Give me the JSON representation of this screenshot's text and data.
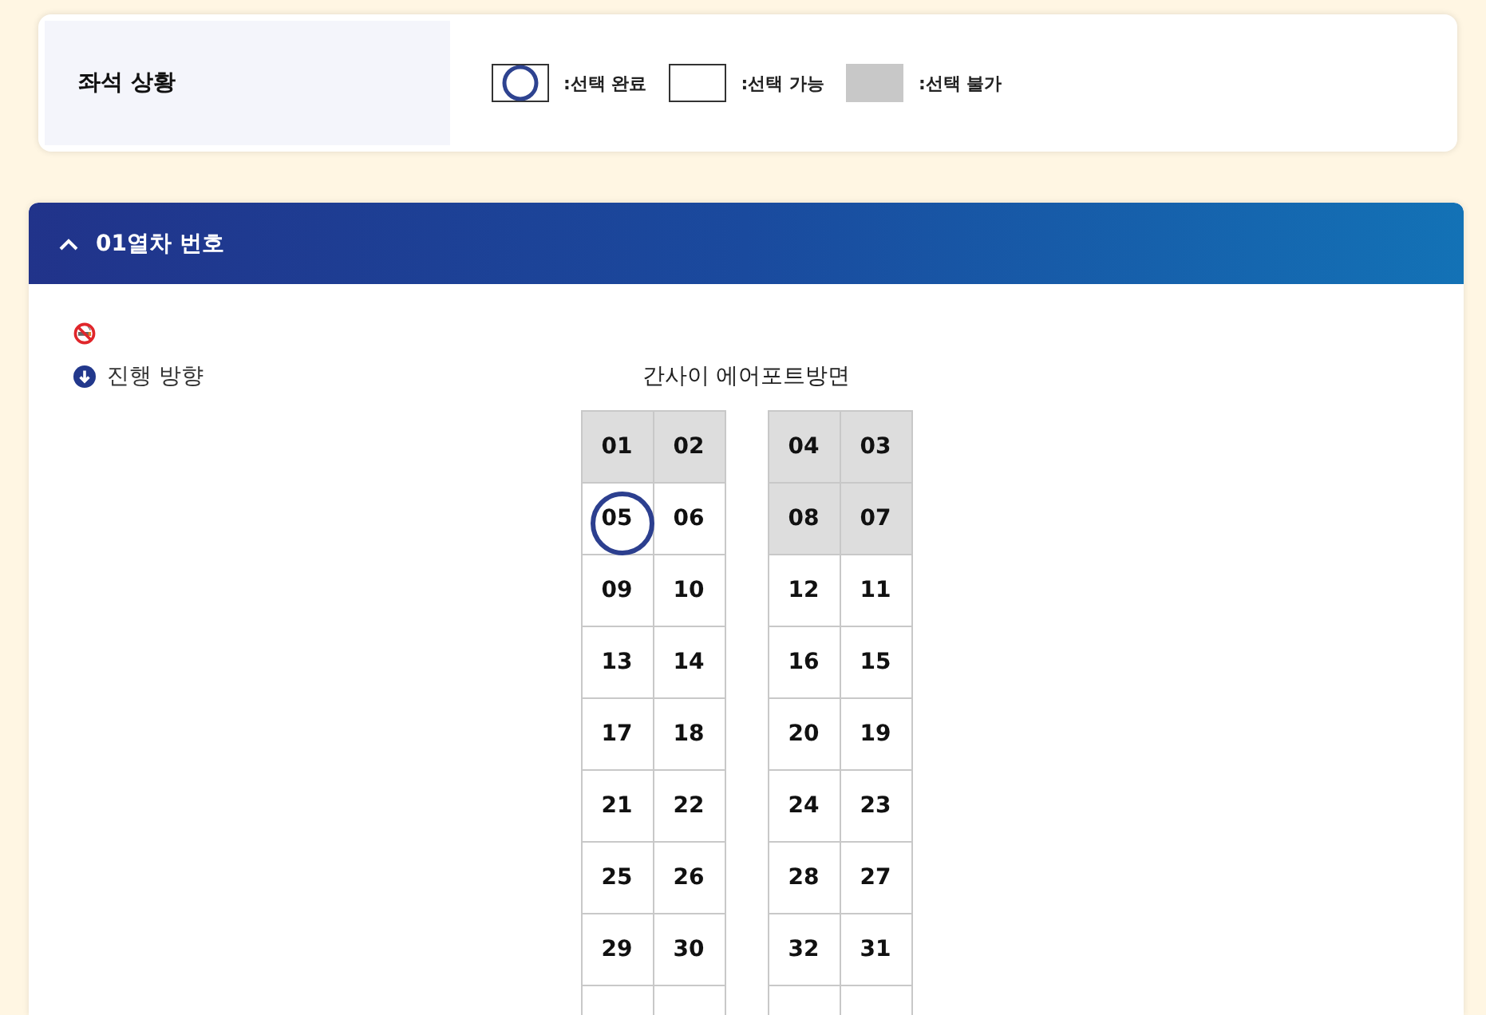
{
  "legend": {
    "title": "좌석 상황",
    "items": [
      {
        "kind": "selected",
        "label": ":선택 완료"
      },
      {
        "kind": "available",
        "label": ":선택 가능"
      },
      {
        "kind": "unavailable",
        "label": ":선택 불가"
      }
    ]
  },
  "car": {
    "title": "01열차 번호",
    "expanded": true,
    "direction_label": "진행 방향",
    "destination": "간사이 에어포트방면",
    "seat_rows": [
      {
        "left": [
          {
            "number": "01",
            "selected": false,
            "disabled": true
          },
          {
            "number": "02",
            "selected": false,
            "disabled": true
          }
        ],
        "right": [
          {
            "number": "04",
            "selected": false,
            "disabled": true
          },
          {
            "number": "03",
            "selected": false,
            "disabled": true
          }
        ]
      },
      {
        "left": [
          {
            "number": "05",
            "selected": true,
            "disabled": false
          },
          {
            "number": "06",
            "selected": false,
            "disabled": false
          }
        ],
        "right": [
          {
            "number": "08",
            "selected": false,
            "disabled": true
          },
          {
            "number": "07",
            "selected": false,
            "disabled": true
          }
        ]
      },
      {
        "left": [
          {
            "number": "09",
            "selected": false,
            "disabled": false
          },
          {
            "number": "10",
            "selected": false,
            "disabled": false
          }
        ],
        "right": [
          {
            "number": "12",
            "selected": false,
            "disabled": false
          },
          {
            "number": "11",
            "selected": false,
            "disabled": false
          }
        ]
      },
      {
        "left": [
          {
            "number": "13",
            "selected": false,
            "disabled": false
          },
          {
            "number": "14",
            "selected": false,
            "disabled": false
          }
        ],
        "right": [
          {
            "number": "16",
            "selected": false,
            "disabled": false
          },
          {
            "number": "15",
            "selected": false,
            "disabled": false
          }
        ]
      },
      {
        "left": [
          {
            "number": "17",
            "selected": false,
            "disabled": false
          },
          {
            "number": "18",
            "selected": false,
            "disabled": false
          }
        ],
        "right": [
          {
            "number": "20",
            "selected": false,
            "disabled": false
          },
          {
            "number": "19",
            "selected": false,
            "disabled": false
          }
        ]
      },
      {
        "left": [
          {
            "number": "21",
            "selected": false,
            "disabled": false
          },
          {
            "number": "22",
            "selected": false,
            "disabled": false
          }
        ],
        "right": [
          {
            "number": "24",
            "selected": false,
            "disabled": false
          },
          {
            "number": "23",
            "selected": false,
            "disabled": false
          }
        ]
      },
      {
        "left": [
          {
            "number": "25",
            "selected": false,
            "disabled": false
          },
          {
            "number": "26",
            "selected": false,
            "disabled": false
          }
        ],
        "right": [
          {
            "number": "28",
            "selected": false,
            "disabled": false
          },
          {
            "number": "27",
            "selected": false,
            "disabled": false
          }
        ]
      },
      {
        "left": [
          {
            "number": "29",
            "selected": false,
            "disabled": false
          },
          {
            "number": "30",
            "selected": false,
            "disabled": false
          }
        ],
        "right": [
          {
            "number": "32",
            "selected": false,
            "disabled": false
          },
          {
            "number": "31",
            "selected": false,
            "disabled": false
          }
        ]
      },
      {
        "left": [
          {
            "selected": false,
            "disabled": false
          },
          {
            "selected": false,
            "disabled": false
          }
        ],
        "right": [
          {
            "selected": false,
            "disabled": false
          },
          {
            "selected": false,
            "disabled": false
          }
        ]
      }
    ]
  }
}
